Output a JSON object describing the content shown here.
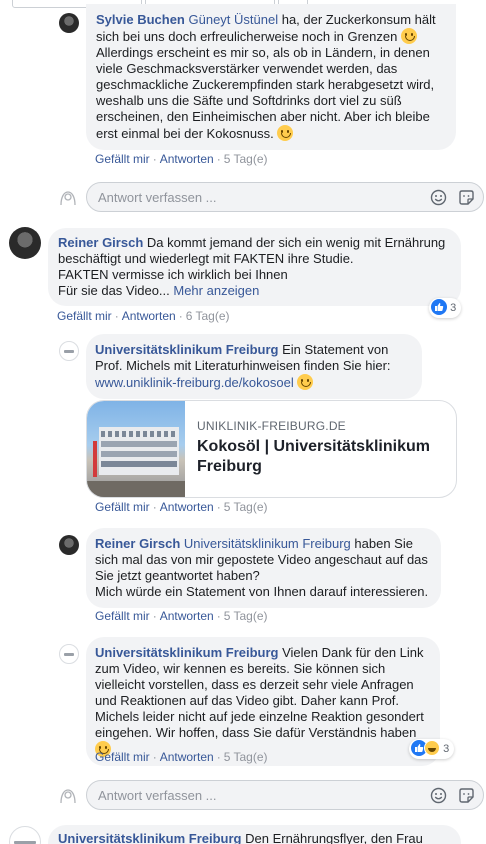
{
  "top_comment": {
    "author": "Sylvie Buchen",
    "mention": "Güneyt Üstünel",
    "text_1": " ha, der Zuckerkonsum hält sich bei uns doch erfreulicherweise noch in Grenzen ",
    "text_2": " Allerdings erscheint es mir so, als ob in Ländern, in denen viele Geschmacksverstärker verwendet werden, das geschmackliche Zuckerempfinden stark herabgesetzt wird, weshalb uns die Säfte und Softdrinks dort viel zu süß erscheinen, den Einheimischen aber nicht. Aber ich bleibe erst einmal bei der Kokosnuss. ",
    "like": "Gefällt mir",
    "reply": "Antworten",
    "time": "5 Tag(e)"
  },
  "reply_box_1": {
    "placeholder": "Antwort verfassen ..."
  },
  "comment_reiner": {
    "author": "Reiner Girsch",
    "text_1": " Da kommt jemand der sich ein wenig mit Ernährung beschäftigt und wiederlegt mit FAKTEN ihre Studie.",
    "text_2": "FAKTEN vermisse ich wirklich bei Ihnen",
    "text_3": "Für sie das Video... ",
    "more": "Mehr anzeigen",
    "like": "Gefällt mir",
    "reply": "Antworten",
    "time": "6 Tag(e)",
    "reaction_count": "3"
  },
  "reply_uk_1": {
    "author": "Universitätsklinikum Freiburg",
    "text": " Ein Statement von Prof. Michels mit Literaturhinweisen finden Sie hier: ",
    "link": "www.uniklinik-freiburg.de/kokosoel",
    "preview_domain": "UNIKLINIK-FREIBURG.DE",
    "preview_title": "Kokosöl | Universitätsklinikum Freiburg",
    "like": "Gefällt mir",
    "reply": "Antworten",
    "time": "5 Tag(e)"
  },
  "reply_reiner": {
    "author": "Reiner Girsch",
    "mention": "Universitätsklinikum Freiburg",
    "text_1": " haben Sie sich mal das von mir gepostete Video angeschaut auf das Sie jetzt geantwortet haben?",
    "text_2": "Mich würde ein Statement von Ihnen darauf interessieren.",
    "like": "Gefällt mir",
    "reply": "Antworten",
    "time": "5 Tag(e)"
  },
  "reply_uk_2": {
    "author": "Universitätsklinikum Freiburg",
    "text": " Vielen Dank für den Link zum Video, wir kennen es bereits. Sie können sich vielleicht vorstellen, dass es derzeit sehr viele Anfragen und Reaktionen auf das Video gibt. Daher kann Prof. Michels leider nicht auf jede einzelne Reaktion gesondert eingehen. Wir hoffen, dass Sie dafür Verständnis haben ",
    "like": "Gefällt mir",
    "reply": "Antworten",
    "time": "5 Tag(e)",
    "reaction_count": "3"
  },
  "reply_box_2": {
    "placeholder": "Antwort verfassen ..."
  },
  "bottom_comment": {
    "author": "Universitätsklinikum Freiburg",
    "text": " Den Ernährungsflyer, den Frau"
  },
  "colors": {
    "link": "#385898",
    "bubble": "#f2f3f5",
    "meta": "#90949c",
    "like_blue": "#2078f4"
  },
  "icons": [
    "smiley-emoji",
    "emoji-picker-icon",
    "sticker-icon",
    "like-reaction-icon",
    "haha-reaction-icon"
  ]
}
